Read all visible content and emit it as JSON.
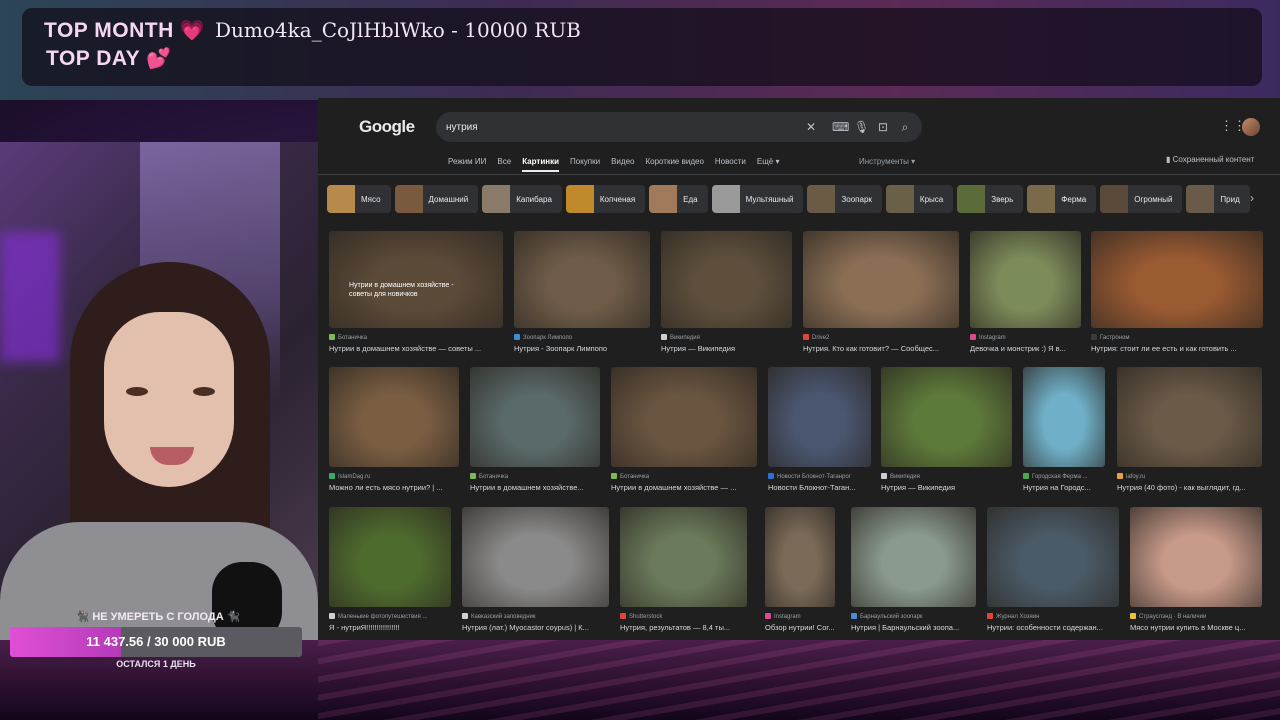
{
  "overlay": {
    "top_month_label": "TOP MONTH",
    "top_day_label": "TOP DAY",
    "top_month_entry": "Dumo4ka_CoJlHblWko - 10000 RUB",
    "heart_glyph": "💗",
    "hearts_glyph": "💕",
    "goal": {
      "title": "🐈‍⬛ НЕ УМЕРЕТЬ С ГОЛОДА 🐈‍⬛",
      "amount": "11 437.56 / 30 000 RUB",
      "progress": 0.381,
      "remaining": "ОСТАЛСЯ 1 ДЕНЬ",
      "accent_color": "#e04fd6"
    }
  },
  "browser": {
    "logo": "Google",
    "search": {
      "value": "нутрия",
      "clear_icon": "close-icon",
      "keyboard_icon": "keyboard-icon",
      "voice_icon": "mic-icon",
      "lens_icon": "camera-icon",
      "search_icon": "search-icon"
    },
    "tabs": [
      {
        "label": "Режим ИИ",
        "active": false
      },
      {
        "label": "Все",
        "active": false
      },
      {
        "label": "Картинки",
        "active": true
      },
      {
        "label": "Покупки",
        "active": false
      },
      {
        "label": "Видео",
        "active": false
      },
      {
        "label": "Короткие видео",
        "active": false
      },
      {
        "label": "Новости",
        "active": false
      },
      {
        "label": "Ещё ▾",
        "active": false
      }
    ],
    "tools_label": "Инструменты ▾",
    "saved_label": "Сохраненный контент",
    "chips": [
      {
        "label": "Мясо",
        "color": "#b58a4a"
      },
      {
        "label": "Домашний",
        "color": "#7a5a3e"
      },
      {
        "label": "Капибара",
        "color": "#8a7a6a"
      },
      {
        "label": "Копченая",
        "color": "#c08a2a"
      },
      {
        "label": "Еда",
        "color": "#a07a5a"
      },
      {
        "label": "Мультяшный",
        "color": "#9a9a9a"
      },
      {
        "label": "Зоопарк",
        "color": "#6b5a45"
      },
      {
        "label": "Крыса",
        "color": "#6a6048"
      },
      {
        "label": "Зверь",
        "color": "#5b6b3a"
      },
      {
        "label": "Ферма",
        "color": "#7a6a4a"
      },
      {
        "label": "Огромный",
        "color": "#5a4a3a"
      },
      {
        "label": "Прид",
        "color": "#6a5a4a"
      }
    ],
    "rows": [
      [
        {
          "source": "Ботаничка",
          "title": "Нутрии в домашнем хозяйстве — советы ...",
          "fav": "#7cbb52",
          "color": "#5b4a38",
          "overlay": "Нутрии в домашнем хозяйстве - советы для новичков"
        },
        {
          "source": "Зоопарк Лимпопо",
          "title": "Нутрия - Зоопарк Лимпопо",
          "fav": "#3b8fd9",
          "color": "#6e5c48"
        },
        {
          "source": "Википедия",
          "title": "Нутрия — Википедия",
          "fav": "#cfcfcf",
          "color": "#5d4f3c"
        },
        {
          "source": "Drive2",
          "title": "Нутрия. Кто как готовит? — Сообщес...",
          "fav": "#e0443a",
          "color": "#8b6f55"
        },
        {
          "source": "Instagram",
          "title": "Девочка и монстрик :) Я в...",
          "fav": "#d94a8c",
          "color": "#7c8b5a"
        },
        {
          "source": "Гастроном",
          "title": "Нутрия: стоит ли ее есть и как готовить ...",
          "fav": "#3c3c3c",
          "color": "#9a5a32"
        }
      ],
      [
        {
          "source": "IslamDag.ru",
          "title": "Можно ли есть мясо нутрии? | ...",
          "fav": "#3aa86b",
          "color": "#7a5e42"
        },
        {
          "source": "Ботаничка",
          "title": "Нутрии в домашнем хозяйстве...",
          "fav": "#7cbb52",
          "color": "#5a6a6a"
        },
        {
          "source": "Ботаничка",
          "title": "Нутрии в домашнем хозяйстве — ...",
          "fav": "#7cbb52",
          "color": "#6a5540"
        },
        {
          "source": "Новости Блокнот-Таганрог",
          "title": "Новости Блокнот-Таган...",
          "fav": "#2d6fd1",
          "color": "#4a5670"
        },
        {
          "source": "Википедия",
          "title": "Нутрия — Википедия",
          "fav": "#cfcfcf",
          "color": "#5e7a3a"
        },
        {
          "source": "Городская Ферма ...",
          "title": "Нутрия на Городс...",
          "fav": "#4aa84a",
          "color": "#6fb0c8"
        },
        {
          "source": "lafoy.ru",
          "title": "Нутрия (40 фото) - как выглядит, гд...",
          "fav": "#e8a23a",
          "color": "#6a5a48"
        }
      ],
      [
        {
          "source": "Маленькие фотопутешествия ...",
          "title": "Я - нутриЯ!!!!!!!!!!!!!!!!",
          "fav": "#cfcfcf",
          "color": "#4e6b2e"
        },
        {
          "source": "Кавказский заповедник",
          "title": "Нутрия (лат.) Myocastor coypus) | К...",
          "fav": "#cfcfcf",
          "color": "#8a8a8a"
        },
        {
          "source": "Shutterstock",
          "title": "Нутрия, результатов — 8,4 ты...",
          "fav": "#e0443a",
          "color": "#6a7a5a"
        },
        {
          "source": "Instagram",
          "title": "Обзор нутрии! Cor...",
          "fav": "#d94a8c",
          "color": "#7a6a58"
        },
        {
          "source": "Барнаульский зоопарк",
          "title": "Нутрия | Барнаульский зоопа...",
          "fav": "#4a8ad9",
          "color": "#8a9a8e"
        },
        {
          "source": "Журнал Хозяин",
          "title": "Нутрии: особенности содержан...",
          "fav": "#e0443a",
          "color": "#4a5a66"
        },
        {
          "source": "Страуслэнд · В наличии",
          "title": "Мясо нутрии купить в Москве ц...",
          "fav": "#e8c23a",
          "color": "#c89a8a"
        }
      ]
    ]
  }
}
